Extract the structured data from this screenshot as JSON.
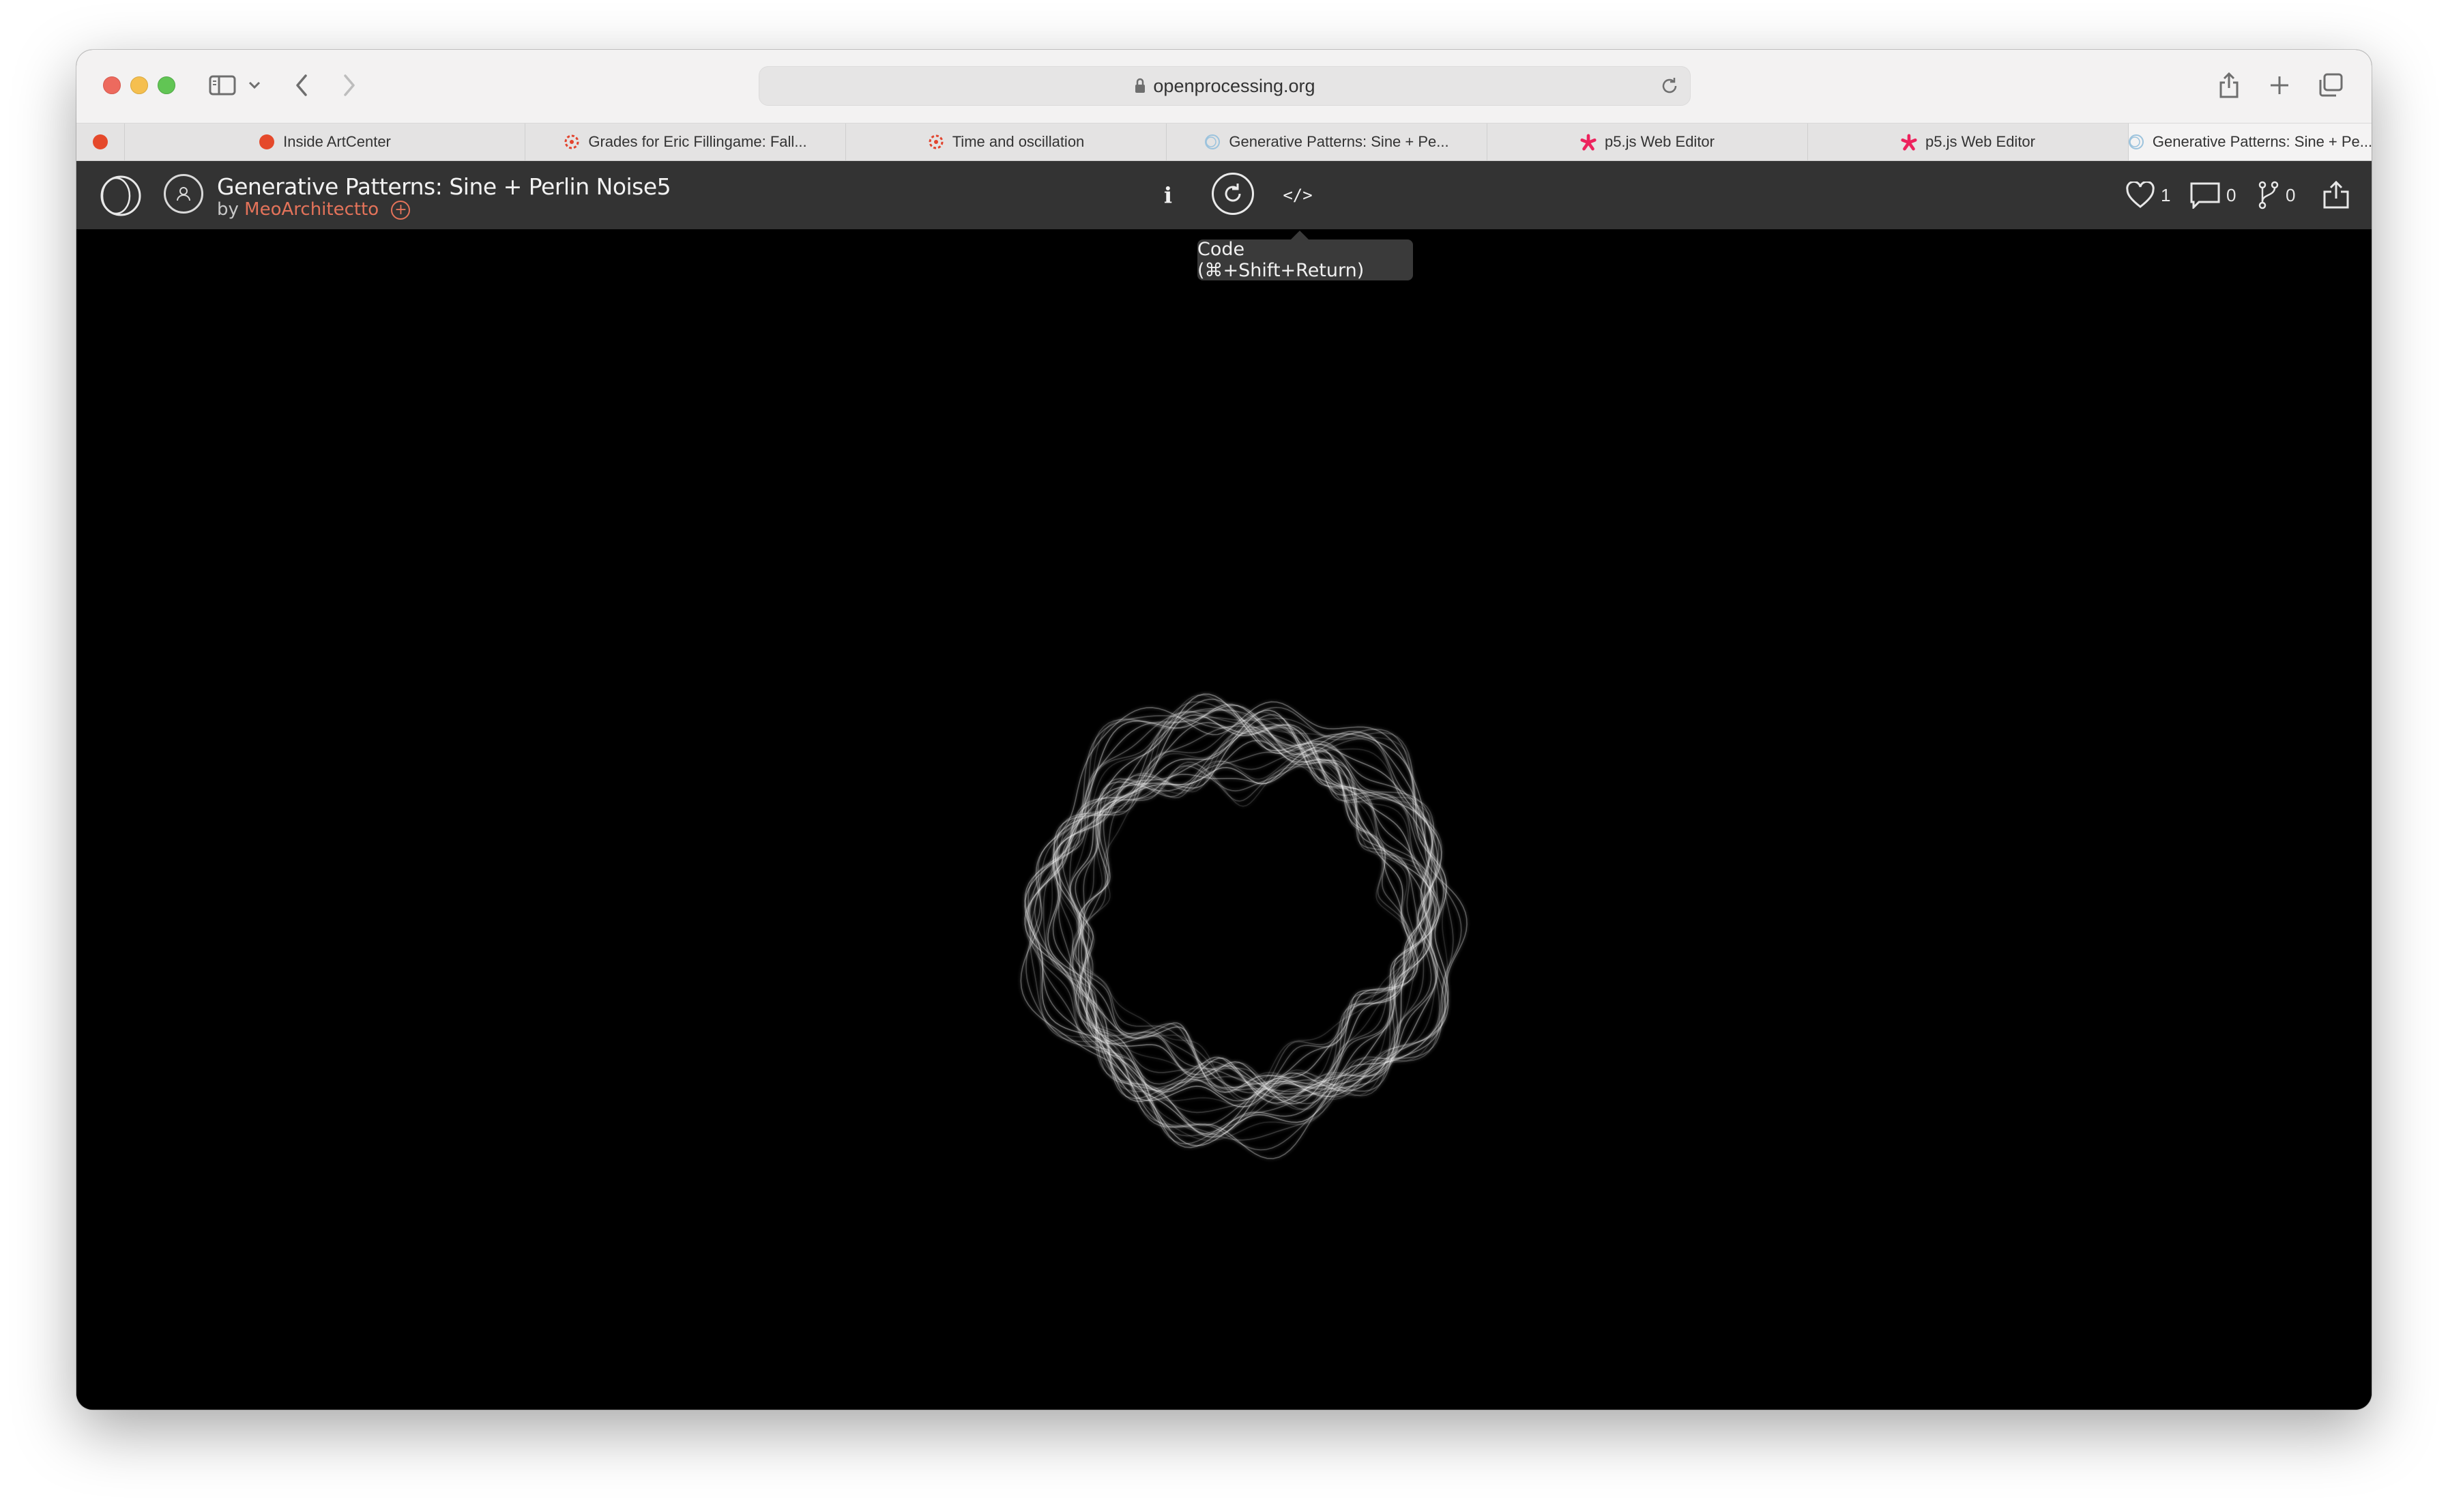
{
  "browser": {
    "address": "openprocessing.org",
    "tabs": [
      {
        "label": "Inside ArtCenter",
        "favicon": "artcenter-dot-icon"
      },
      {
        "label": "Grades for Eric Fillingame: Fall...",
        "favicon": "canvas-lms-icon"
      },
      {
        "label": "Time and oscillation",
        "favicon": "canvas-lms-icon"
      },
      {
        "label": "Generative Patterns: Sine + Pe...",
        "favicon": "openprocessing-icon"
      },
      {
        "label": "p5.js Web Editor",
        "favicon": "p5js-asterisk-icon"
      },
      {
        "label": "p5.js Web Editor",
        "favicon": "p5js-asterisk-icon"
      },
      {
        "label": "Generative Patterns: Sine + Pe...",
        "favicon": "openprocessing-icon",
        "active": true
      }
    ]
  },
  "sketch": {
    "title": "Generative Patterns: Sine + Perlin Noise5",
    "by_prefix": "by",
    "author": "MeoArchitectto",
    "info_label": "i",
    "code_label": "</>",
    "tooltip": "Code (⌘+Shift+Return)",
    "likes": "1",
    "comments": "0",
    "forks": "0"
  },
  "colors": {
    "header_bg": "#333333",
    "author": "#e4735a",
    "canvas_bg": "#000000"
  }
}
